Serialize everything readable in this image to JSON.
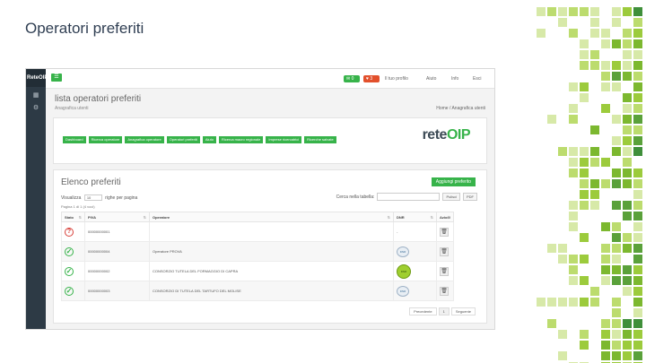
{
  "slide": {
    "title": "Operatori preferiti"
  },
  "app": {
    "brand": "ReteOIP",
    "menu_icon": "list-icon",
    "sidebar_icons": [
      "grid-icon",
      "gear-icon"
    ],
    "top": {
      "badge_green": "0",
      "badge_red": "3",
      "links": [
        "Il tuo profilo",
        "Aiuto",
        "Info",
        "Esci"
      ]
    },
    "page_title": "lista operatori preferiti",
    "page_subtitle": "Anagrafica utenti",
    "breadcrumb": "Home / Anagrafica utenti",
    "toolbar_buttons": [
      "Dashboard",
      "Ricerca operatore",
      "Anagrafica operatore",
      "Operatori preferiti",
      "Aiuto",
      "Ricerca macro regionale",
      "Imprese ricercatrici",
      "Ricerche salvate"
    ],
    "logo": {
      "rete": "rete",
      "oip": "OIP"
    },
    "list": {
      "title": "Elenco preferiti",
      "add_button": "Aggiungi preferito",
      "show_prefix": "Visualizza",
      "show_value": "10",
      "show_suffix": "righe per pagina",
      "search_label": "Cerca nella tabella:",
      "search_placeholder": "",
      "reset_button": "Pulisci",
      "pdf_button": "PDF",
      "records": "Pagina 1 di 1 (4 voci)",
      "columns": [
        "Stato",
        "PIVA",
        "Operatore",
        "DNR",
        "Azioni"
      ],
      "rows": [
        {
          "status": "pending",
          "piva": "00000000001",
          "operator": "",
          "dnr": "-"
        },
        {
          "status": "ok",
          "piva": "00000000004",
          "operator": "Operatore PROVA",
          "dnr": "logo"
        },
        {
          "status": "ok",
          "piva": "00000000002",
          "operator": "CONSORZIO TUTELA DEL FORMAGGIO DI CAPRA",
          "dnr": "logo-green"
        },
        {
          "status": "ok",
          "piva": "00000000003",
          "operator": "CONSORZIO DI TUTELA DEL TARTUFO DEL MOLISE",
          "dnr": "logo"
        }
      ],
      "pager": {
        "prev": "Precedente",
        "page": "1",
        "next": "Seguente"
      }
    }
  },
  "colors": {
    "green": "#37b34a",
    "red": "#e2502c",
    "sidebar": "#2d3a45"
  }
}
